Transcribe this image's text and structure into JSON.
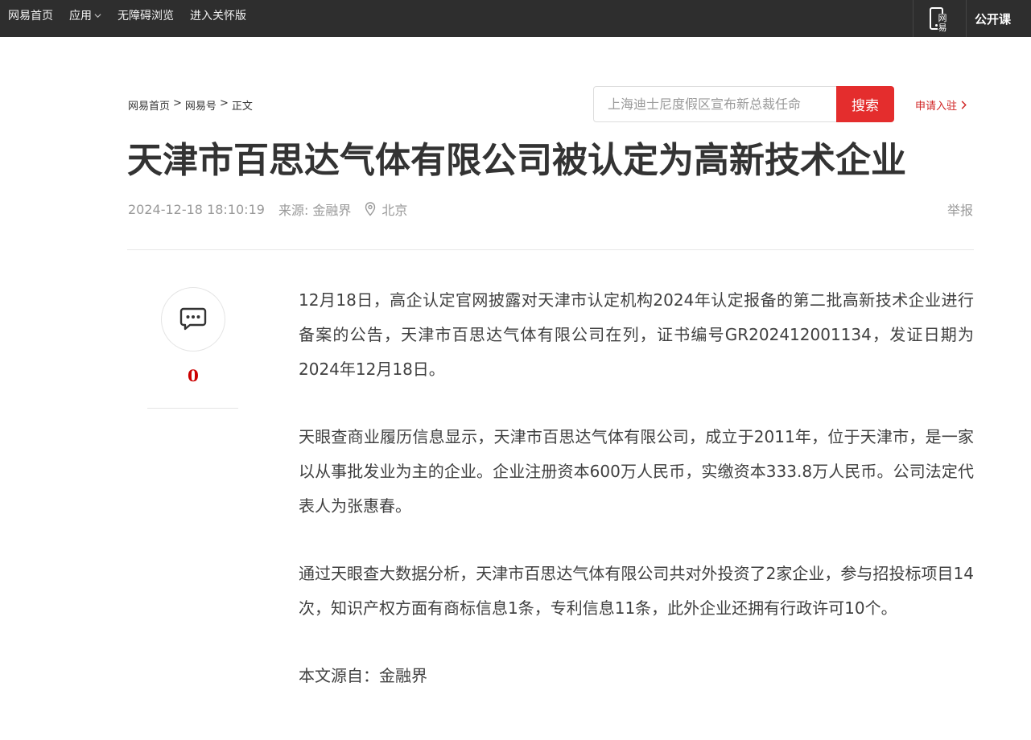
{
  "topbar": {
    "nav": [
      {
        "label": "网易首页"
      },
      {
        "label": "应用",
        "has_dropdown": true
      },
      {
        "label": "无障碍浏览"
      },
      {
        "label": "进入关怀版"
      }
    ],
    "app_icon_text": "网易",
    "open_course": "公开课"
  },
  "breadcrumb": {
    "items": [
      "网易首页",
      "网易号",
      "正文"
    ],
    "separator": ">"
  },
  "search": {
    "placeholder": "上海迪士尼度假区宣布新总裁任命",
    "button_label": "搜索"
  },
  "join_label": "申请入驻",
  "article": {
    "title": "天津市百思达气体有限公司被认定为高新技术企业",
    "time": "2024-12-18 18:10:19",
    "source": "来源: 金融界",
    "location": "北京",
    "report": "举报",
    "paragraphs": [
      "12月18日，高企认定官网披露对天津市认定机构2024年认定报备的第二批高新技术企业进行备案的公告，天津市百思达气体有限公司在列，证书编号GR202412001134，发证日期为2024年12月18日。",
      "天眼查商业履历信息显示，天津市百思达气体有限公司，成立于2011年，位于天津市，是一家以从事批发业为主的企业。企业注册资本600万人民币，实缴资本333.8万人民币。公司法定代表人为张惠春。",
      "通过天眼查大数据分析，天津市百思达气体有限公司共对外投资了2家企业，参与招投标项目14次，知识产权方面有商标信息1条，专利信息11条，此外企业还拥有行政许可10个。"
    ],
    "source_note": "本文源自：金融界"
  },
  "comment": {
    "count": "0"
  },
  "colors": {
    "topbar_bg": "#2e2e2e",
    "accent_red": "#e42d2d",
    "join_red": "#d02323",
    "title": "#333333",
    "meta_gray": "#999999"
  }
}
